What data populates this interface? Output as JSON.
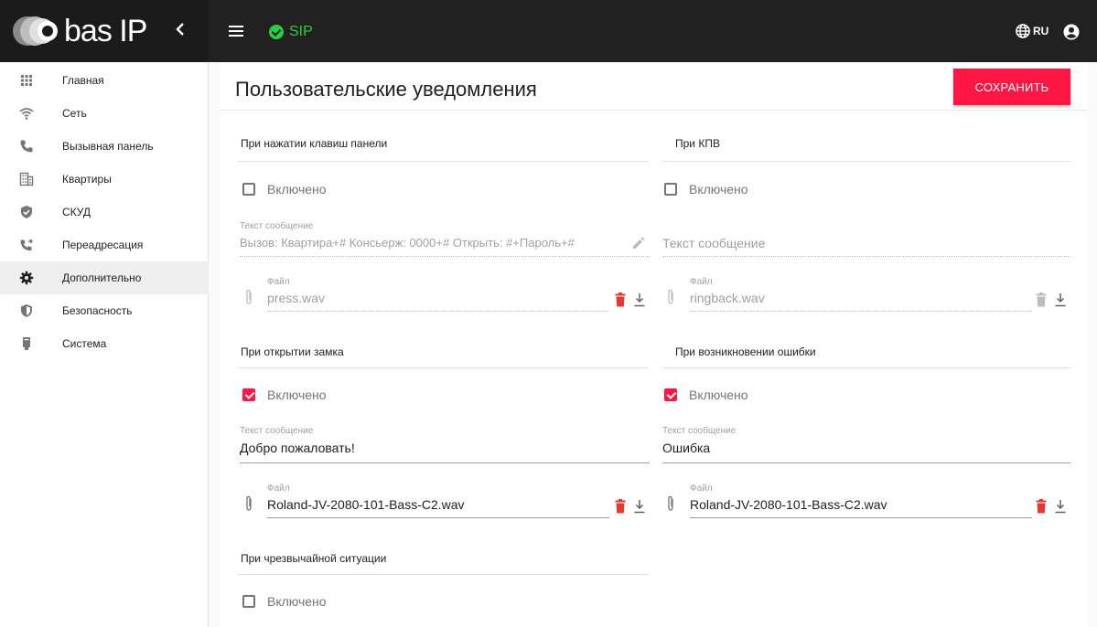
{
  "header": {
    "logo_text": "bas IP",
    "sip_label": "SIP",
    "lang_label": "RU"
  },
  "sidebar": {
    "items": [
      {
        "label": "Главная",
        "icon": "apps-grid-icon"
      },
      {
        "label": "Сеть",
        "icon": "wifi-icon"
      },
      {
        "label": "Вызывная панель",
        "icon": "phone-icon"
      },
      {
        "label": "Квартиры",
        "icon": "building-icon"
      },
      {
        "label": "СКУД",
        "icon": "shield-check-icon"
      },
      {
        "label": "Переадресация",
        "icon": "phone-forward-icon"
      },
      {
        "label": "Дополнительно",
        "icon": "gear-icon"
      },
      {
        "label": "Безопасность",
        "icon": "security-shield-icon"
      },
      {
        "label": "Система",
        "icon": "device-icon"
      }
    ],
    "active_index": 6
  },
  "page": {
    "title": "Пользовательские уведомления",
    "save_label": "СОХРАНИТЬ"
  },
  "sections": {
    "keypress": {
      "title": "При нажатии клавиш панели",
      "enabled_label": "Включено",
      "enabled": false,
      "message_label": "Текст сообщение",
      "message_value": "Вызов:  Квартира+# Консьерж:  0000+# Открыть:  #+Пароль+#",
      "file_label": "Файл",
      "file_value": "press.wav"
    },
    "kpv": {
      "title": "При КПВ",
      "enabled_label": "Включено",
      "enabled": false,
      "message_placeholder": "Текст сообщение",
      "file_label": "Файл",
      "file_value": "ringback.wav"
    },
    "lock_open": {
      "title": "При открытии замка",
      "enabled_label": "Включено",
      "enabled": true,
      "message_label": "Текст сообщение",
      "message_value": "Добро пожаловать!",
      "file_label": "Файл",
      "file_value": "Roland-JV-2080-101-Bass-C2.wav"
    },
    "error": {
      "title": "При возникновении ошибки",
      "enabled_label": "Включено",
      "enabled": true,
      "message_label": "Текст сообщение",
      "message_value": "Ошибка",
      "file_label": "Файл",
      "file_value": "Roland-JV-2080-101-Bass-C2.wav"
    },
    "emergency": {
      "title": "При чрезвычайной ситуации",
      "enabled_label": "Включено",
      "enabled": false
    }
  },
  "colors": {
    "accent": "#ff1744",
    "sip_ok": "#2ecc40",
    "topbar": "#212121"
  }
}
